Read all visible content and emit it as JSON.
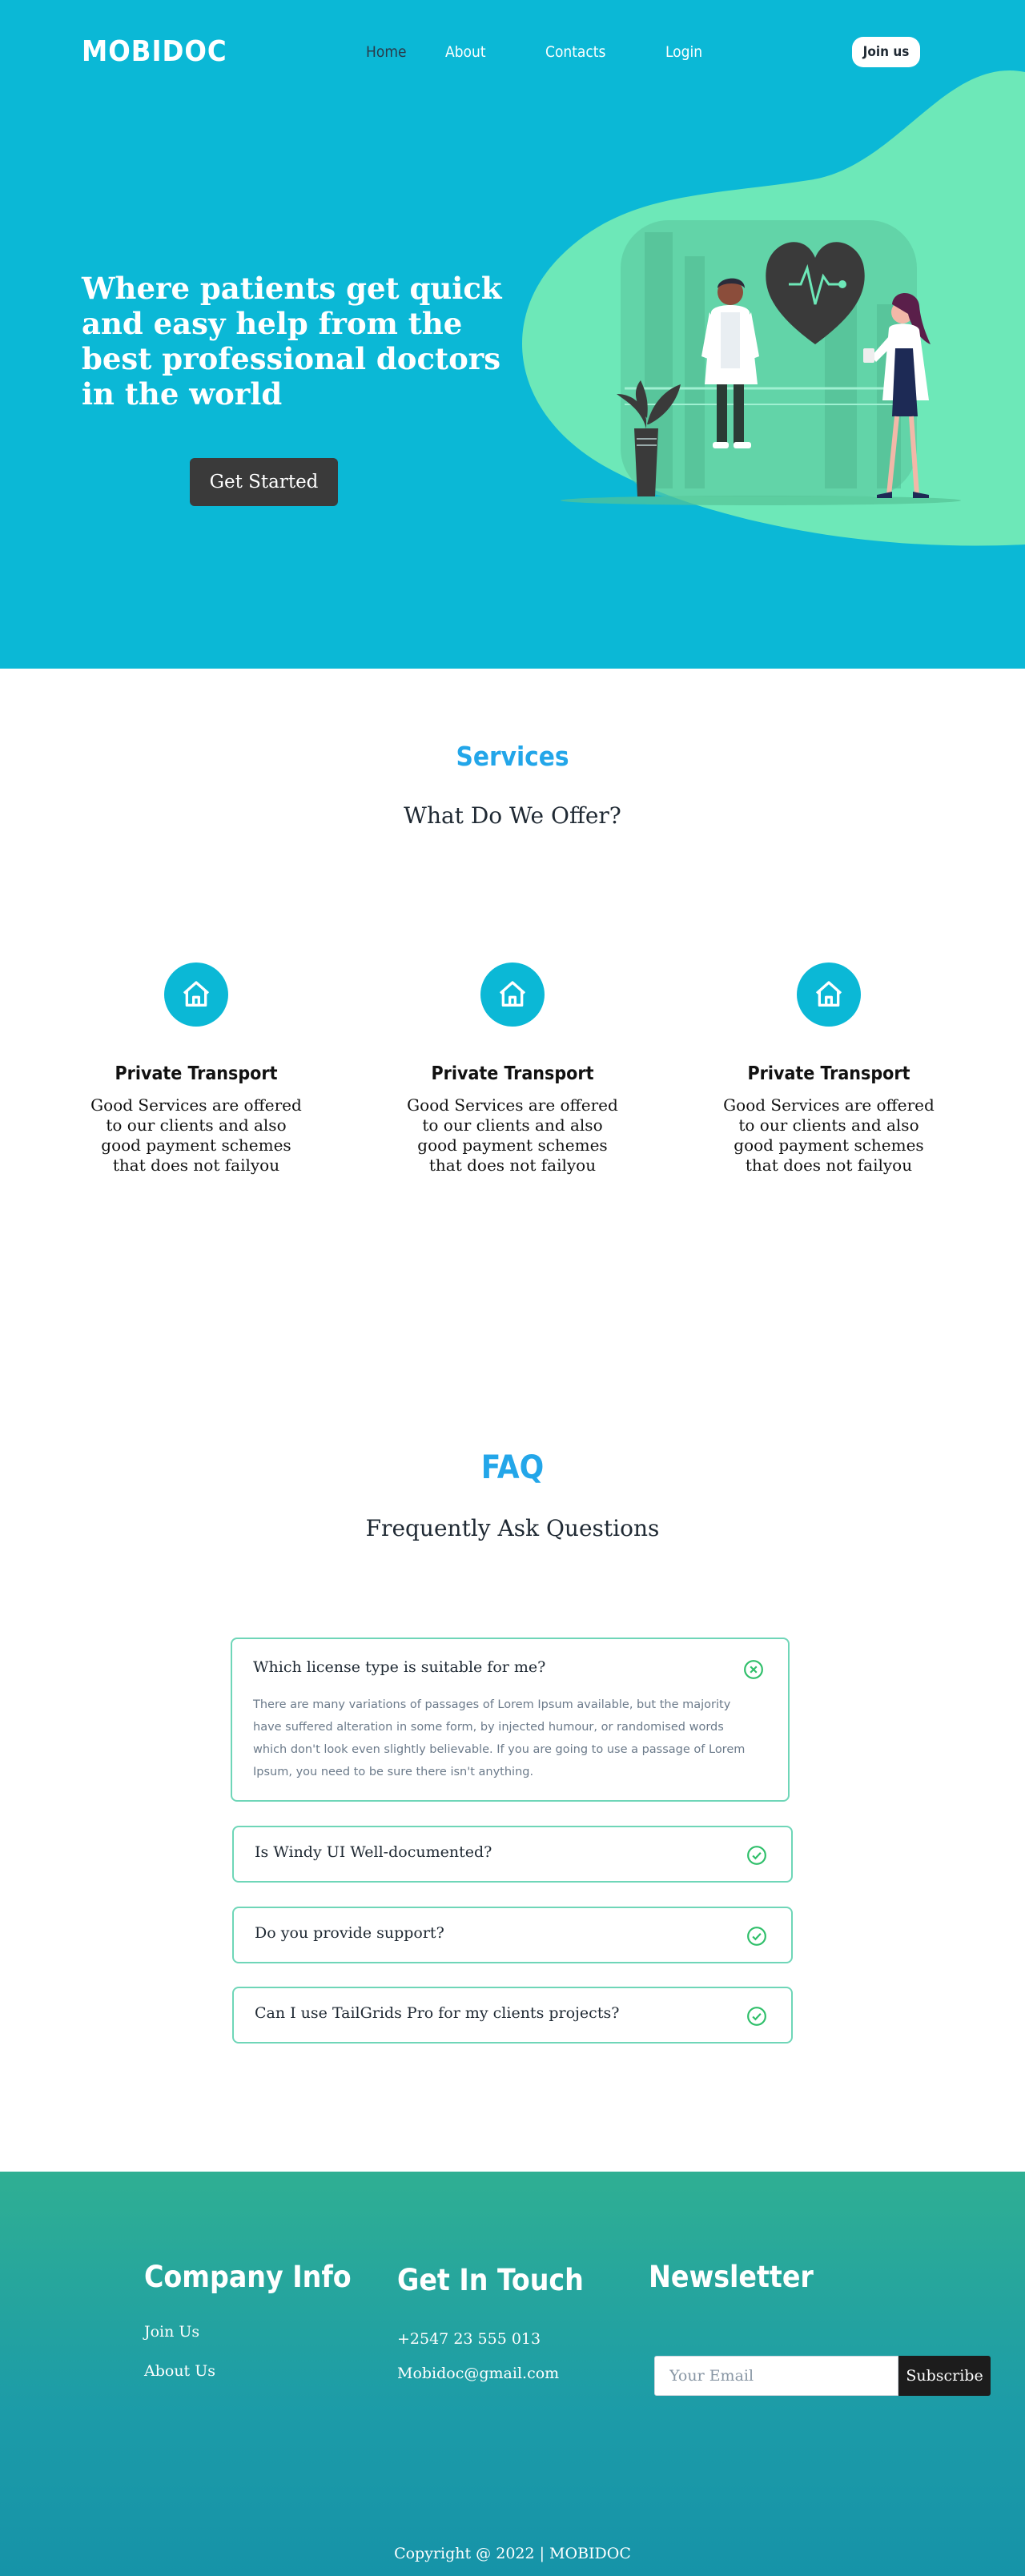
{
  "header": {
    "logo": "MOBIDOC",
    "nav": [
      "Home",
      "About",
      "Contacts",
      "Login"
    ],
    "join_label": "Join us"
  },
  "hero": {
    "title": "Where patients get quick and easy help from the best professional doctors in the world",
    "cta_label": "Get Started"
  },
  "services": {
    "label": "Services",
    "subtitle": "What Do We Offer?",
    "items": [
      {
        "icon": "home-icon",
        "title": "Private Transport",
        "text": "Good Services are offered to our clients  and also good payment schemes that does not failyou"
      },
      {
        "icon": "home-icon",
        "title": "Private Transport",
        "text": "Good Services are offered to our clients  and also good payment schemes that does not failyou"
      },
      {
        "icon": "home-icon",
        "title": "Private Transport",
        "text": "Good Services are offered to our clients  and also good payment schemes that does not failyou"
      }
    ]
  },
  "faq": {
    "label": "FAQ",
    "subtitle": "Frequently Ask Questions",
    "items": [
      {
        "question": "Which license type is suitable for me?",
        "answer": "There are many variations of passages of Lorem Ipsum available, but the majority have suffered alteration in some form, by injected humour, or randomised words which don't look even slightly believable. If you are going to use a passage of Lorem Ipsum, you need to be sure there isn't anything.",
        "icon": "close-circle-icon"
      },
      {
        "question": "Is Windy UI Well-documented?",
        "icon": "check-circle-icon"
      },
      {
        "question": "Do you provide support?",
        "icon": "check-circle-icon"
      },
      {
        "question": "Can I use TailGrids Pro for my clients projects?",
        "icon": "check-circle-icon"
      }
    ]
  },
  "footer": {
    "company_heading": "Company Info",
    "company_links": [
      "Join Us",
      "About Us"
    ],
    "touch_heading": "Get In Touch",
    "phone": "+2547 23 555 013",
    "email": "Mobidoc@gmail.com",
    "newsletter_heading": "Newsletter",
    "email_placeholder": "Your Email",
    "subscribe_label": "Subscribe",
    "copyright": "Copyright @ 2022 | MOBIDOC"
  },
  "colors": {
    "hero_bg": "#0bb8d6",
    "blob": "#6de8b8",
    "accent": "#23a6e9",
    "faq_border": "#6fd6b8",
    "check": "#2fbf6a",
    "close": "#2fbf6a"
  }
}
